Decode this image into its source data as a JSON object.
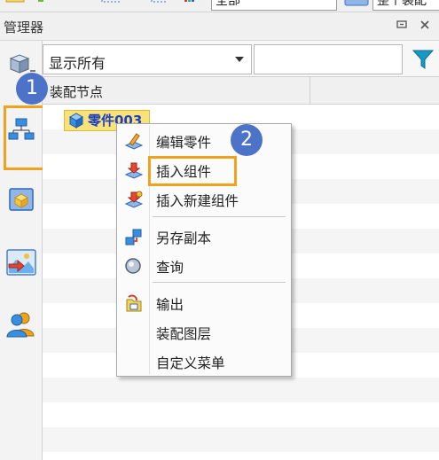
{
  "toolbar": {
    "field1_text": "全部",
    "field2_text": "整个装配"
  },
  "panel": {
    "title": "管理器",
    "pin_icon": "pin-icon",
    "close_icon": "close-icon"
  },
  "left_tabs": [
    {
      "name": "assembly-tree-tab-icon",
      "highlighted": true
    },
    {
      "name": "part-tab-icon"
    },
    {
      "name": "view-tab-icon"
    },
    {
      "name": "user-tab-icon"
    }
  ],
  "filter": {
    "selected": "显示所有",
    "search_value": "",
    "filter_icon": "funnel-icon"
  },
  "tree": {
    "header": "装配节点",
    "node_label": "零件003"
  },
  "menu": {
    "items": [
      {
        "label": "编辑零件",
        "icon": "edit-part-icon"
      },
      {
        "label": "插入组件",
        "icon": "insert-component-icon",
        "highlighted": true
      },
      {
        "label": "插入新建组件",
        "icon": "insert-new-component-icon"
      },
      {
        "label": "另存副本",
        "icon": "save-copy-icon"
      },
      {
        "label": "查询",
        "icon": "query-icon"
      },
      {
        "label": "输出",
        "icon": "export-icon"
      },
      {
        "label": "装配图层",
        "icon": ""
      },
      {
        "label": "自定义菜单",
        "icon": ""
      }
    ]
  },
  "badges": [
    "1",
    "2"
  ],
  "colors": {
    "highlight": "#f0a21b",
    "badge": "#4d73c8",
    "node_bg": "#f8e27a",
    "node_text": "#1e3fbf"
  }
}
